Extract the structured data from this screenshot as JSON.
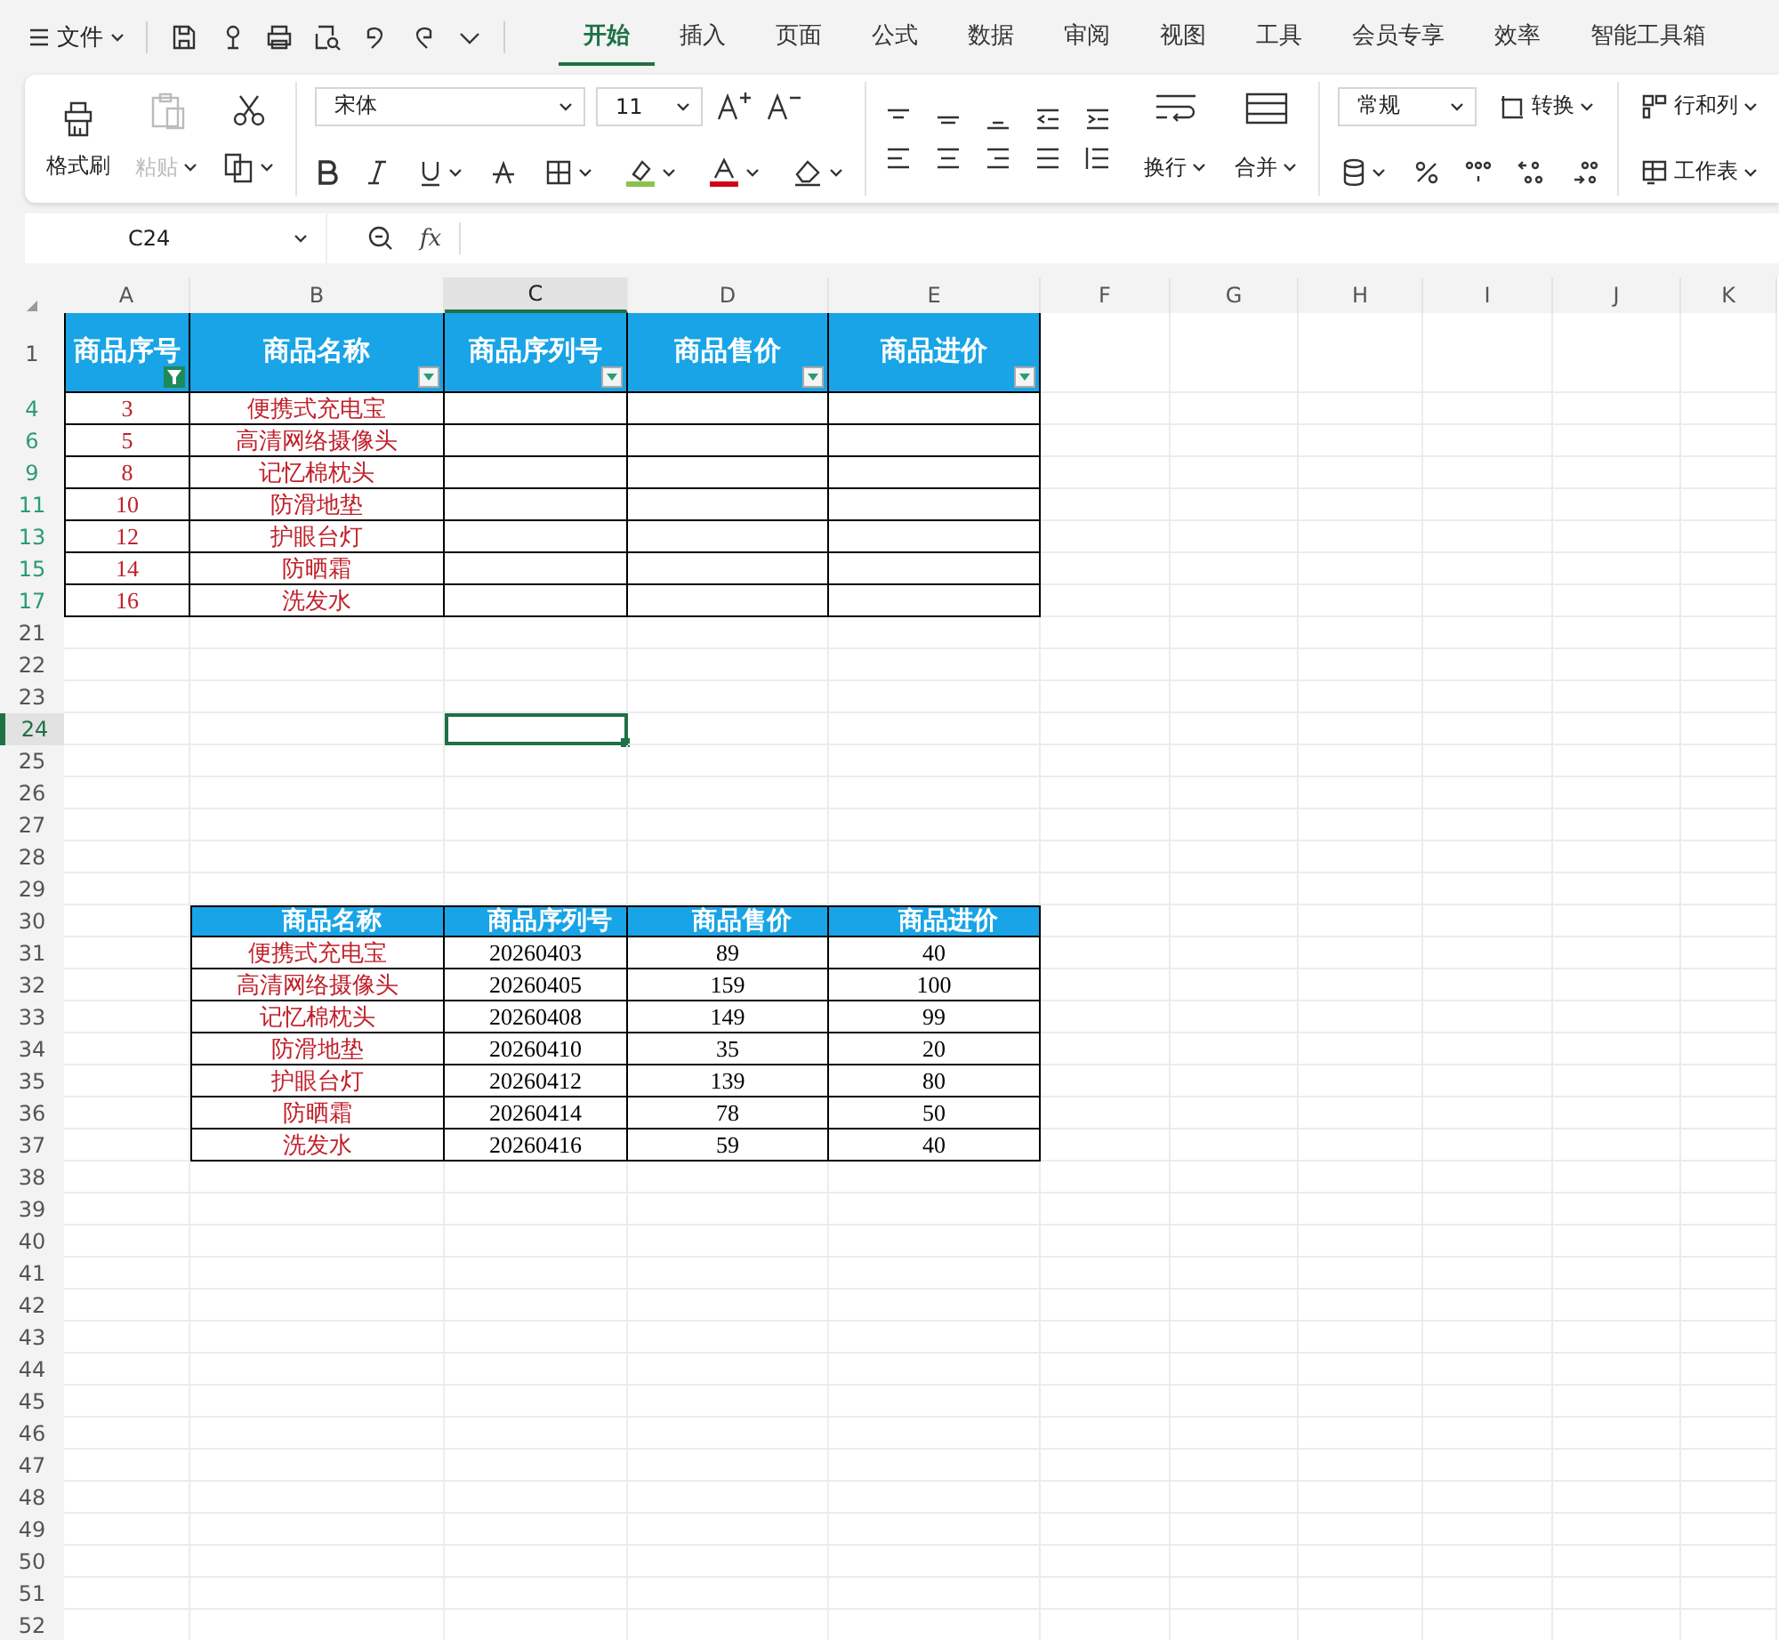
{
  "menu": {
    "file_label": "文件"
  },
  "tabs": [
    {
      "label": "开始",
      "selected": true
    },
    {
      "label": "插入",
      "selected": false
    },
    {
      "label": "页面",
      "selected": false
    },
    {
      "label": "公式",
      "selected": false
    },
    {
      "label": "数据",
      "selected": false
    },
    {
      "label": "审阅",
      "selected": false
    },
    {
      "label": "视图",
      "selected": false
    },
    {
      "label": "工具",
      "selected": false
    },
    {
      "label": "会员专享",
      "selected": false
    },
    {
      "label": "效率",
      "selected": false
    },
    {
      "label": "智能工具箱",
      "selected": false
    }
  ],
  "ribbon": {
    "clipboard": {
      "format_painter": "格式刷",
      "paste": {
        "label": "粘贴",
        "disabled": true
      }
    },
    "font": {
      "name": "宋体",
      "size": "11"
    },
    "alignment": {
      "wrap": "换行",
      "merge": "合并"
    },
    "number": {
      "format": "常规",
      "convert": "转换"
    },
    "cells": {
      "rows_columns": "行和列",
      "worksheet": "工作表"
    }
  },
  "formula_bar": {
    "cell_ref": "C24",
    "function_label": "fx"
  },
  "sheet": {
    "columns": [
      {
        "letter": "A",
        "selected": false
      },
      {
        "letter": "B",
        "selected": false
      },
      {
        "letter": "C",
        "selected": true
      },
      {
        "letter": "D",
        "selected": false
      },
      {
        "letter": "E",
        "selected": false
      },
      {
        "letter": "F",
        "selected": false
      },
      {
        "letter": "G",
        "selected": false
      },
      {
        "letter": "H",
        "selected": false
      },
      {
        "letter": "I",
        "selected": false
      },
      {
        "letter": "J",
        "selected": false
      },
      {
        "letter": "K",
        "selected": false
      }
    ],
    "rows": [
      {
        "number": "1",
        "kind": "header",
        "selected": false,
        "filtered": false,
        "cells": [
          {
            "kind": "value",
            "text": "商品序号",
            "filtered": true
          },
          {
            "kind": "value",
            "text": "商品名称",
            "filtered": false
          },
          {
            "kind": "value",
            "text": "商品序列号",
            "filtered": false
          },
          {
            "kind": "value",
            "text": "商品售价",
            "filtered": false
          },
          {
            "kind": "value",
            "text": "商品进价",
            "filtered": false
          }
        ]
      },
      {
        "number": "4",
        "kind": "data",
        "selected": false,
        "filtered": true,
        "cells": [
          {
            "kind": "value",
            "text": "3",
            "color": "#c0202a"
          },
          {
            "kind": "value",
            "text": "便携式充电宝",
            "color": "#c0202a"
          },
          {
            "kind": "empty"
          },
          {
            "kind": "empty"
          },
          {
            "kind": "empty"
          }
        ]
      },
      {
        "number": "6",
        "kind": "data",
        "selected": false,
        "filtered": true,
        "cells": [
          {
            "kind": "value",
            "text": "5",
            "color": "#c0202a"
          },
          {
            "kind": "value",
            "text": "高清网络摄像头",
            "color": "#c0202a"
          },
          {
            "kind": "empty"
          },
          {
            "kind": "empty"
          },
          {
            "kind": "empty"
          }
        ]
      },
      {
        "number": "9",
        "kind": "data",
        "selected": false,
        "filtered": true,
        "cells": [
          {
            "kind": "value",
            "text": "8",
            "color": "#c0202a"
          },
          {
            "kind": "value",
            "text": "记忆棉枕头",
            "color": "#c0202a"
          },
          {
            "kind": "empty"
          },
          {
            "kind": "empty"
          },
          {
            "kind": "empty"
          }
        ]
      },
      {
        "number": "11",
        "kind": "data",
        "selected": false,
        "filtered": true,
        "cells": [
          {
            "kind": "value",
            "text": "10",
            "color": "#c0202a"
          },
          {
            "kind": "value",
            "text": "防滑地垫",
            "color": "#c0202a"
          },
          {
            "kind": "empty"
          },
          {
            "kind": "empty"
          },
          {
            "kind": "empty"
          }
        ]
      },
      {
        "number": "13",
        "kind": "data",
        "selected": false,
        "filtered": true,
        "cells": [
          {
            "kind": "value",
            "text": "12",
            "color": "#c0202a"
          },
          {
            "kind": "value",
            "text": "护眼台灯",
            "color": "#c0202a"
          },
          {
            "kind": "empty"
          },
          {
            "kind": "empty"
          },
          {
            "kind": "empty"
          }
        ]
      },
      {
        "number": "15",
        "kind": "data",
        "selected": false,
        "filtered": true,
        "cells": [
          {
            "kind": "value",
            "text": "14",
            "color": "#c0202a"
          },
          {
            "kind": "value",
            "text": "防晒霜",
            "color": "#c0202a"
          },
          {
            "kind": "empty"
          },
          {
            "kind": "empty"
          },
          {
            "kind": "empty"
          }
        ]
      },
      {
        "number": "17",
        "kind": "data",
        "selected": false,
        "filtered": true,
        "cells": [
          {
            "kind": "value",
            "text": "16",
            "color": "#c0202a"
          },
          {
            "kind": "value",
            "text": "洗发水",
            "color": "#c0202a"
          },
          {
            "kind": "empty"
          },
          {
            "kind": "empty"
          },
          {
            "kind": "empty"
          }
        ]
      },
      {
        "number": "21",
        "kind": "blank",
        "selected": false,
        "filtered": false
      },
      {
        "number": "22",
        "kind": "blank",
        "selected": false,
        "filtered": false
      },
      {
        "number": "23",
        "kind": "blank",
        "selected": false,
        "filtered": false
      },
      {
        "number": "24",
        "kind": "blank",
        "selected": true,
        "filtered": false
      },
      {
        "number": "25",
        "kind": "blank",
        "selected": false,
        "filtered": false
      },
      {
        "number": "26",
        "kind": "blank",
        "selected": false,
        "filtered": false
      },
      {
        "number": "27",
        "kind": "blank",
        "selected": false,
        "filtered": false
      },
      {
        "number": "28",
        "kind": "blank",
        "selected": false,
        "filtered": false
      },
      {
        "number": "29",
        "kind": "blank",
        "selected": false,
        "filtered": false
      },
      {
        "number": "30",
        "kind": "subheader",
        "selected": false,
        "filtered": false,
        "cells": [
          {
            "kind": "outside"
          },
          {
            "kind": "value",
            "text": "商品名称"
          },
          {
            "kind": "value",
            "text": "商品序列号"
          },
          {
            "kind": "value",
            "text": "商品售价"
          },
          {
            "kind": "value",
            "text": "商品进价"
          }
        ]
      },
      {
        "number": "31",
        "kind": "data",
        "selected": false,
        "filtered": false,
        "cells": [
          {
            "kind": "outside"
          },
          {
            "kind": "value",
            "text": "便携式充电宝",
            "color": "#c0202a"
          },
          {
            "kind": "value",
            "text": "20260403",
            "color": "#000000"
          },
          {
            "kind": "value",
            "text": "89",
            "color": "#000000"
          },
          {
            "kind": "value",
            "text": "40",
            "color": "#000000"
          }
        ]
      },
      {
        "number": "32",
        "kind": "data",
        "selected": false,
        "filtered": false,
        "cells": [
          {
            "kind": "outside"
          },
          {
            "kind": "value",
            "text": "高清网络摄像头",
            "color": "#c0202a"
          },
          {
            "kind": "value",
            "text": "20260405",
            "color": "#000000"
          },
          {
            "kind": "value",
            "text": "159",
            "color": "#000000"
          },
          {
            "kind": "value",
            "text": "100",
            "color": "#000000"
          }
        ]
      },
      {
        "number": "33",
        "kind": "data",
        "selected": false,
        "filtered": false,
        "cells": [
          {
            "kind": "outside"
          },
          {
            "kind": "value",
            "text": "记忆棉枕头",
            "color": "#c0202a"
          },
          {
            "kind": "value",
            "text": "20260408",
            "color": "#000000"
          },
          {
            "kind": "value",
            "text": "149",
            "color": "#000000"
          },
          {
            "kind": "value",
            "text": "99",
            "color": "#000000"
          }
        ]
      },
      {
        "number": "34",
        "kind": "data",
        "selected": false,
        "filtered": false,
        "cells": [
          {
            "kind": "outside"
          },
          {
            "kind": "value",
            "text": "防滑地垫",
            "color": "#c0202a"
          },
          {
            "kind": "value",
            "text": "20260410",
            "color": "#000000"
          },
          {
            "kind": "value",
            "text": "35",
            "color": "#000000"
          },
          {
            "kind": "value",
            "text": "20",
            "color": "#000000"
          }
        ]
      },
      {
        "number": "35",
        "kind": "data",
        "selected": false,
        "filtered": false,
        "cells": [
          {
            "kind": "outside"
          },
          {
            "kind": "value",
            "text": "护眼台灯",
            "color": "#c0202a"
          },
          {
            "kind": "value",
            "text": "20260412",
            "color": "#000000"
          },
          {
            "kind": "value",
            "text": "139",
            "color": "#000000"
          },
          {
            "kind": "value",
            "text": "80",
            "color": "#000000"
          }
        ]
      },
      {
        "number": "36",
        "kind": "data",
        "selected": false,
        "filtered": false,
        "cells": [
          {
            "kind": "outside"
          },
          {
            "kind": "value",
            "text": "防晒霜",
            "color": "#c0202a"
          },
          {
            "kind": "value",
            "text": "20260414",
            "color": "#000000"
          },
          {
            "kind": "value",
            "text": "78",
            "color": "#000000"
          },
          {
            "kind": "value",
            "text": "50",
            "color": "#000000"
          }
        ]
      },
      {
        "number": "37",
        "kind": "data",
        "selected": false,
        "filtered": false,
        "cells": [
          {
            "kind": "outside"
          },
          {
            "kind": "value",
            "text": "洗发水",
            "color": "#c0202a"
          },
          {
            "kind": "value",
            "text": "20260416",
            "color": "#000000"
          },
          {
            "kind": "value",
            "text": "59",
            "color": "#000000"
          },
          {
            "kind": "value",
            "text": "40",
            "color": "#000000"
          }
        ]
      },
      {
        "number": "38",
        "kind": "blank",
        "selected": false,
        "filtered": false
      },
      {
        "number": "39",
        "kind": "blank",
        "selected": false,
        "filtered": false
      },
      {
        "number": "40",
        "kind": "blank",
        "selected": false,
        "filtered": false
      },
      {
        "number": "41",
        "kind": "blank",
        "selected": false,
        "filtered": false
      },
      {
        "number": "42",
        "kind": "blank",
        "selected": false,
        "filtered": false
      },
      {
        "number": "43",
        "kind": "blank",
        "selected": false,
        "filtered": false
      },
      {
        "number": "44",
        "kind": "blank",
        "selected": false,
        "filtered": false
      },
      {
        "number": "45",
        "kind": "blank",
        "selected": false,
        "filtered": false
      },
      {
        "number": "46",
        "kind": "blank",
        "selected": false,
        "filtered": false
      },
      {
        "number": "47",
        "kind": "blank",
        "selected": false,
        "filtered": false
      },
      {
        "number": "48",
        "kind": "blank",
        "selected": false,
        "filtered": false
      },
      {
        "number": "49",
        "kind": "blank",
        "selected": false,
        "filtered": false
      },
      {
        "number": "50",
        "kind": "blank",
        "selected": false,
        "filtered": false
      },
      {
        "number": "51",
        "kind": "blank",
        "selected": false,
        "filtered": false
      },
      {
        "number": "52",
        "kind": "blank",
        "selected": false,
        "filtered": false
      }
    ]
  }
}
